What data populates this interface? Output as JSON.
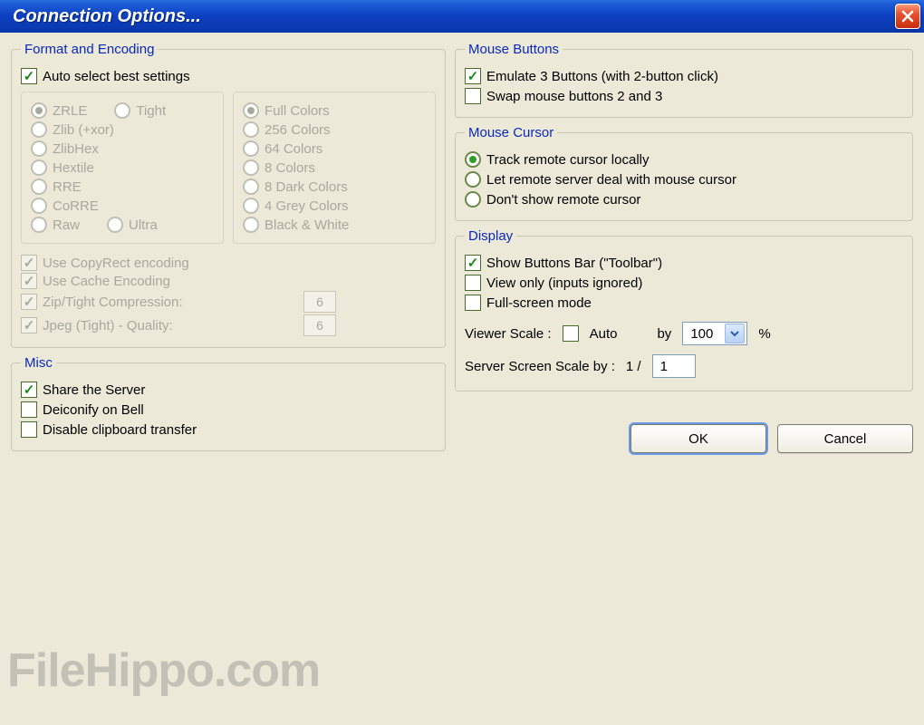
{
  "window": {
    "title": "Connection Options..."
  },
  "format": {
    "legend": "Format and Encoding",
    "auto_select": "Auto select best settings",
    "encodings": [
      "ZRLE",
      "Tight",
      "Zlib (+xor)",
      "ZlibHex",
      "Hextile",
      "RRE",
      "CoRRE",
      "Raw",
      "Ultra"
    ],
    "colors": [
      "Full Colors",
      "256 Colors",
      "64 Colors",
      "8 Colors",
      "8 Dark Colors",
      "4 Grey Colors",
      "Black & White"
    ],
    "copyrect": "Use CopyRect encoding",
    "cache": "Use Cache Encoding",
    "zip": "Zip/Tight Compression:",
    "zip_val": "6",
    "jpeg": "Jpeg (Tight) - Quality:",
    "jpeg_val": "6"
  },
  "misc": {
    "legend": "Misc",
    "share": "Share the Server",
    "deiconify": "Deiconify on Bell",
    "noclip": "Disable clipboard transfer"
  },
  "mouse_buttons": {
    "legend": "Mouse Buttons",
    "emulate3": "Emulate 3 Buttons (with 2-button click)",
    "swap": "Swap mouse buttons 2 and 3"
  },
  "mouse_cursor": {
    "legend": "Mouse Cursor",
    "opt1": "Track remote cursor locally",
    "opt2": "Let remote server deal with mouse cursor",
    "opt3": "Don't show remote cursor"
  },
  "display": {
    "legend": "Display",
    "toolbar": "Show Buttons Bar (\"Toolbar\")",
    "view_only": "View only (inputs ignored)",
    "fullscreen": "Full-screen mode",
    "viewer_scale_label": "Viewer Scale :",
    "auto": "Auto",
    "by": "by",
    "scale_val": "100",
    "percent": "%",
    "server_scale_label": "Server Screen Scale by :",
    "one_over": "1  /",
    "server_scale_val": "1"
  },
  "buttons": {
    "ok": "OK",
    "cancel": "Cancel"
  },
  "watermark": "FileHippo.com"
}
